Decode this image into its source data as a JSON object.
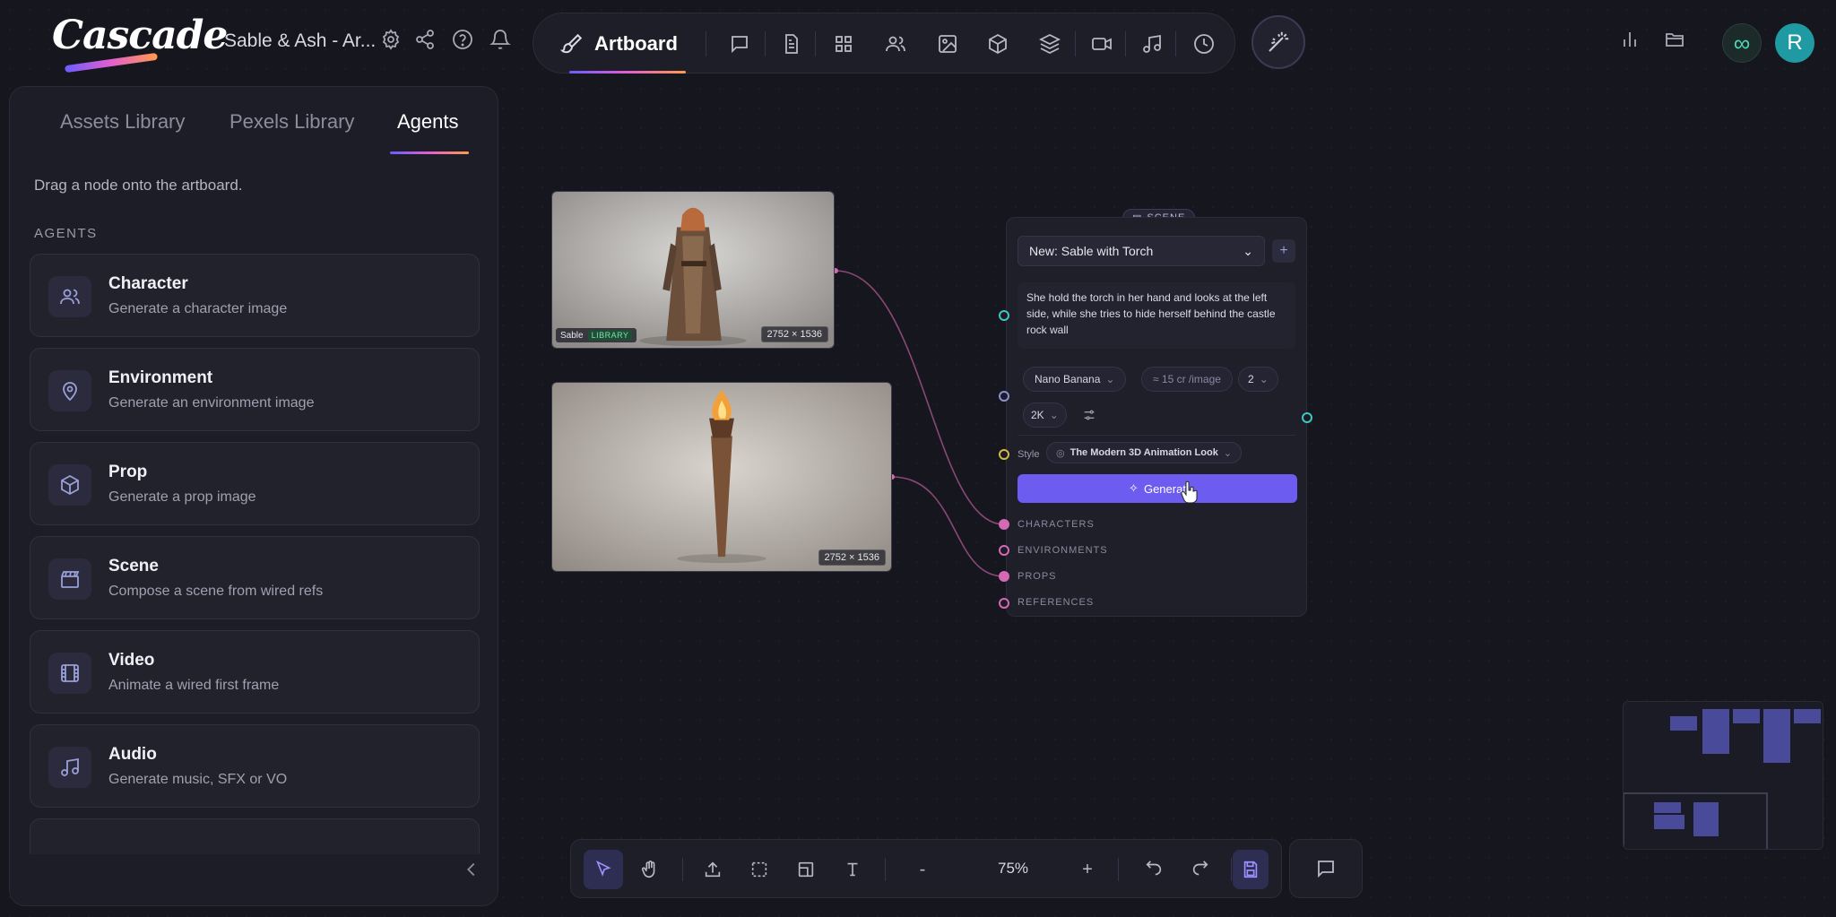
{
  "app": {
    "name": "Cascade",
    "project_title": "Sable & Ash - Ar..."
  },
  "toolbar": {
    "mode_label": "Artboard",
    "icons": [
      "chat-icon",
      "document-icon",
      "grid-icon",
      "users-icon",
      "image-icon",
      "cube-icon",
      "layers-icon",
      "video-icon",
      "music-icon",
      "clock-icon"
    ]
  },
  "header_right": {
    "avatar_initial": "R",
    "infinity_glyph": "∞"
  },
  "left_panel": {
    "tabs": [
      {
        "label": "Assets Library"
      },
      {
        "label": "Pexels Library"
      },
      {
        "label": "Agents"
      }
    ],
    "active_tab": "Agents",
    "hint": "Drag a node onto the artboard.",
    "section_label": "AGENTS",
    "agents": [
      {
        "title": "Character",
        "description": "Generate a character image",
        "icon": "users-icon"
      },
      {
        "title": "Environment",
        "description": "Generate an environment image",
        "icon": "map-pin-icon"
      },
      {
        "title": "Prop",
        "description": "Generate a prop image",
        "icon": "cube-icon"
      },
      {
        "title": "Scene",
        "description": "Compose a scene from wired refs",
        "icon": "clapperboard-icon"
      },
      {
        "title": "Video",
        "description": "Animate a wired first frame",
        "icon": "film-icon"
      },
      {
        "title": "Audio",
        "description": "Generate music, SFX or VO",
        "icon": "music-icon"
      }
    ]
  },
  "nodes": {
    "character_image": {
      "name": "Sable",
      "tag": "LIBRARY",
      "dimensions": "2752 × 1536"
    },
    "prop_image": {
      "dimensions": "2752 × 1536"
    }
  },
  "scene_node": {
    "badge": "SCENE",
    "selected_scene": "New: Sable with Torch",
    "prompt": "She hold the torch in her hand and looks at the left side, while she tries to hide herself behind the castle rock wall",
    "model": "Nano Banana",
    "cost": "≈ 15 cr /image",
    "count": "2",
    "resolution": "2K",
    "style_label": "Style",
    "style_value": "The Modern 3D Animation Look",
    "generate_label": "Generat",
    "ports": [
      "CHARACTERS",
      "ENVIRONMENTS",
      "PROPS",
      "REFERENCES"
    ]
  },
  "bottom_toolbar": {
    "zoom": "75%",
    "minus": "-",
    "plus": "+"
  },
  "colors": {
    "accent": "#6c5cf0",
    "gradient": [
      "#6b5cff",
      "#e25fd0",
      "#ff9a4a"
    ],
    "port_teal": "#3fc7c0",
    "port_pink": "#d46ab4",
    "port_gold": "#d4b84a"
  }
}
